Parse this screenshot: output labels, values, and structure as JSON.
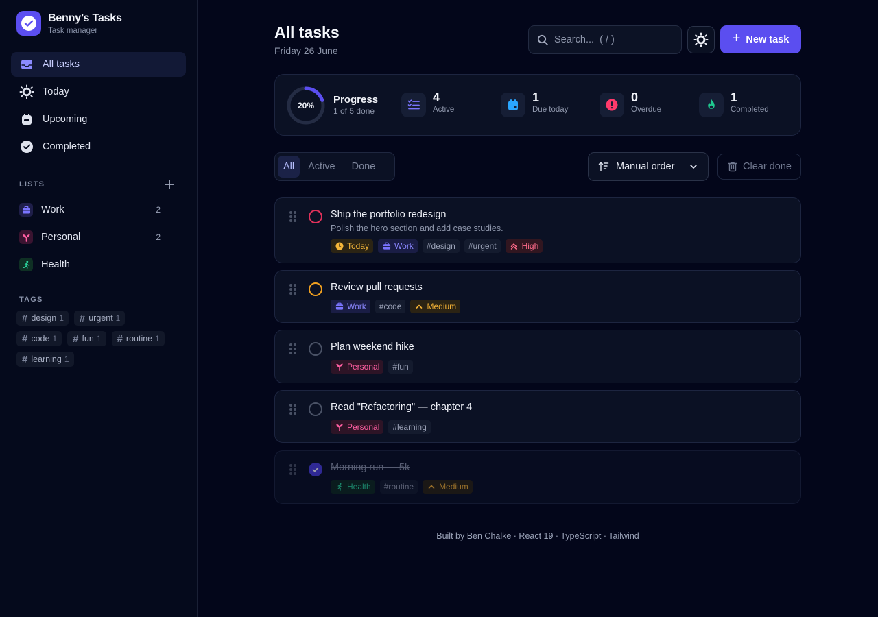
{
  "brand": {
    "title": "Benny’s Tasks",
    "subtitle": "Task manager"
  },
  "nav": [
    {
      "label": "All tasks",
      "icon": "inbox-icon",
      "active": true
    },
    {
      "label": "Today",
      "icon": "sun-icon"
    },
    {
      "label": "Upcoming",
      "icon": "calendar-icon"
    },
    {
      "label": "Completed",
      "icon": "check-circle-icon"
    }
  ],
  "lists_section": {
    "label": "LISTS"
  },
  "lists": [
    {
      "label": "Work",
      "count": "2",
      "icon": "briefcase-icon",
      "color": "#7a74ff"
    },
    {
      "label": "Personal",
      "count": "2",
      "icon": "sprout-icon",
      "color": "#ff5fa2"
    },
    {
      "label": "Health",
      "count": "",
      "icon": "runner-icon",
      "color": "#2ad19a"
    }
  ],
  "tags_section": {
    "label": "TAGS"
  },
  "tags": [
    {
      "label": "design",
      "count": "1"
    },
    {
      "label": "urgent",
      "count": "1"
    },
    {
      "label": "code",
      "count": "1"
    },
    {
      "label": "fun",
      "count": "1"
    },
    {
      "label": "routine",
      "count": "1"
    },
    {
      "label": "learning",
      "count": "1"
    }
  ],
  "header": {
    "title": "All tasks",
    "date": "Friday 26 June"
  },
  "search": {
    "placeholder": "Search...  ( / )"
  },
  "new_task": {
    "label": "New task"
  },
  "progress": {
    "percent_label": "20%",
    "percent": 0.2,
    "title": "Progress",
    "subtitle": "1 of 5 done"
  },
  "stats": [
    {
      "value": "4",
      "label": "Active",
      "icon": "list-checks-icon",
      "color": "#7a74ff"
    },
    {
      "value": "1",
      "label": "Due today",
      "icon": "calendar-today-icon",
      "color": "#2aa6ff"
    },
    {
      "value": "0",
      "label": "Overdue",
      "icon": "alert-icon",
      "color": "#ff3a6b"
    },
    {
      "value": "1",
      "label": "Completed",
      "icon": "flame-icon",
      "color": "#1fc98f"
    }
  ],
  "filters": {
    "all": "All",
    "active": "Active",
    "done": "Done",
    "selected": "All"
  },
  "sort": {
    "label": "Manual order"
  },
  "clear_done": {
    "label": "Clear done"
  },
  "tasks": [
    {
      "title": "Ship the portfolio redesign",
      "description": "Polish the hero section and add case studies.",
      "status_color": "#e0315a",
      "chips": {
        "due": "Today",
        "list": "Work",
        "tag1": "#design",
        "tag2": "#urgent",
        "priority": "High"
      }
    },
    {
      "title": "Review pull requests",
      "status_color": "#f0a020",
      "chips": {
        "list": "Work",
        "tag1": "#code",
        "priority": "Medium"
      }
    },
    {
      "title": "Plan weekend hike",
      "status_color": "#4a5266",
      "chips": {
        "list": "Personal",
        "tag1": "#fun"
      }
    },
    {
      "title": "Read \"Refactoring\" — chapter 4",
      "status_color": "#4a5266",
      "chips": {
        "list": "Personal",
        "tag1": "#learning"
      }
    },
    {
      "title": "Morning run — 5k",
      "done": true,
      "chips": {
        "list": "Health",
        "tag1": "#routine",
        "priority": "Medium"
      }
    }
  ],
  "footer": {
    "text": "Built by Ben Chalke · React 19 · TypeScript · Tailwind"
  },
  "colors": {
    "accent": "#5b4ef0",
    "background": "#03061a"
  }
}
